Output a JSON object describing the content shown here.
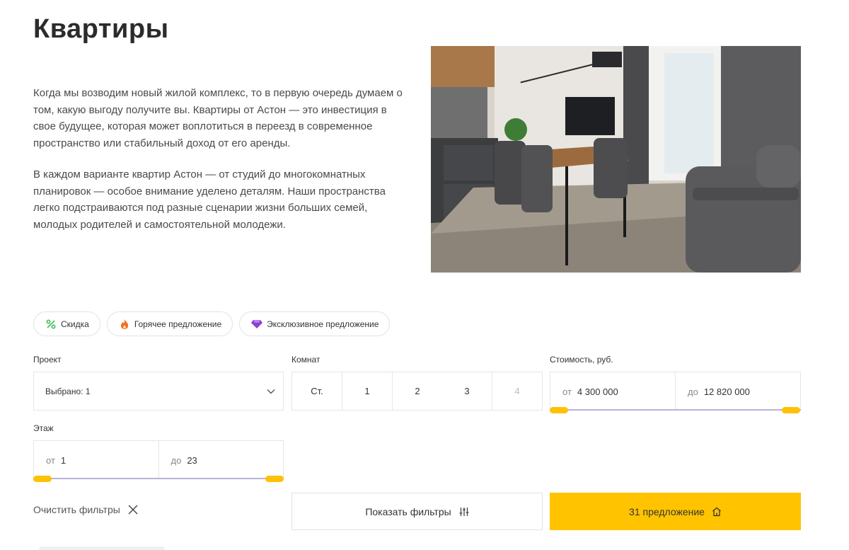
{
  "page": {
    "title": "Квартиры",
    "intro": [
      "Когда мы возводим новый жилой комплекс, то в первую очередь думаем о том, какую выгоду получите вы. Квартиры от Астон — это инвестиция в свое будущее, которая может воплотиться в переезд в современное пространство или стабильный доход от его аренды.",
      "В каждом варианте квартир Астон — от студий до многокомнатных планировок — особое внимание уделено деталям. Наши пространства легко подстраиваются под разные сценарии жизни больших семей, молодых родителей и самостоятельной молодежи."
    ]
  },
  "tags": [
    {
      "label": "Скидка",
      "icon": "percent-icon",
      "color": "#3fbf5a"
    },
    {
      "label": "Горячее предложение",
      "icon": "flame-icon",
      "color": "#f26b1d"
    },
    {
      "label": "Эксклюзивное предложение",
      "icon": "diamond-icon",
      "color": "#8e3fd6"
    }
  ],
  "filters": {
    "project": {
      "label": "Проект",
      "value": "Выбрано: 1"
    },
    "rooms": {
      "label": "Комнат",
      "options": [
        "Ст.",
        "1",
        "2",
        "3",
        "4"
      ]
    },
    "price": {
      "label": "Стоимость, руб.",
      "from_prefix": "от",
      "from": "4 300 000",
      "to_prefix": "до",
      "to": "12 820 000"
    },
    "floor": {
      "label": "Этаж",
      "from_prefix": "от",
      "from": "1",
      "to_prefix": "до",
      "to": "23"
    }
  },
  "actions": {
    "clear": "Очистить фильтры",
    "show_filters": "Показать фильтры",
    "offers": "31 предложение"
  },
  "colors": {
    "accent": "#ffc300",
    "slider_track": "#b9b2d6",
    "knob": "#ffc107"
  }
}
